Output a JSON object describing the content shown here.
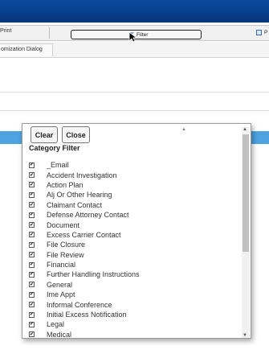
{
  "toolbar": {
    "print_label": "Print",
    "filter_label": "Filter",
    "right_label": "P",
    "filter_icon": "filter-icon",
    "right_icon": "calendar-icon"
  },
  "tabs": {
    "active_label": "omization Dialog"
  },
  "popup": {
    "clear_label": "Clear",
    "close_label": "Close",
    "title": "Category Filter",
    "items": [
      {
        "label": "_Email",
        "checked": true
      },
      {
        "label": "Accident Investigation",
        "checked": true
      },
      {
        "label": "Action Plan",
        "checked": true
      },
      {
        "label": "Alj Or Other Hearing",
        "checked": true
      },
      {
        "label": "Claimant Contact",
        "checked": true
      },
      {
        "label": "Defense Attorney Contact",
        "checked": true
      },
      {
        "label": "Document",
        "checked": true
      },
      {
        "label": "Excess Carrier Contact",
        "checked": true
      },
      {
        "label": "File Closure",
        "checked": true
      },
      {
        "label": "File Review",
        "checked": true
      },
      {
        "label": "Financial",
        "checked": true
      },
      {
        "label": "Further Handling Instructions",
        "checked": true
      },
      {
        "label": "General",
        "checked": true
      },
      {
        "label": "Ime Appt",
        "checked": true
      },
      {
        "label": "Informal Conference",
        "checked": true
      },
      {
        "label": "Initial Excess Notification",
        "checked": true
      },
      {
        "label": "Legal",
        "checked": true
      },
      {
        "label": "Medical",
        "checked": true
      }
    ]
  },
  "colors": {
    "topbar": "#0a4aa0",
    "selected_row": "#4da3e0"
  }
}
